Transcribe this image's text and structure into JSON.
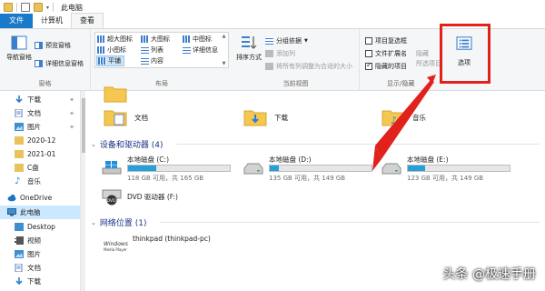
{
  "titlebar": {
    "title": "此电脑"
  },
  "tabs": [
    {
      "label": "文件"
    },
    {
      "label": "计算机"
    },
    {
      "label": "查看"
    }
  ],
  "ribbon": {
    "pane_group": {
      "label": "窗格",
      "nav_pane": "导航窗格",
      "preview_pane": "预览窗格",
      "details_pane": "详细信息窗格"
    },
    "layout_group": {
      "label": "布局",
      "items": [
        "超大图标",
        "大图标",
        "中图标",
        "小图标",
        "列表",
        "详细信息",
        "平铺",
        "内容"
      ],
      "selected": "平铺"
    },
    "current_view_group": {
      "label": "当前视图",
      "sort_by": "排序方式",
      "group_by": "分组依据",
      "add_column": "添加列",
      "fit_columns": "将所有列调整为合适的大小"
    },
    "show_hide_group": {
      "label": "显示/隐藏",
      "item_checkboxes": {
        "label": "项目复选框",
        "checked": false
      },
      "file_extensions": {
        "label": "文件扩展名",
        "checked": false
      },
      "hidden_items": {
        "label": "隐藏的项目",
        "checked": true
      },
      "hide": "隐藏",
      "hide_selected": "所选项目"
    },
    "options": {
      "label": "选项"
    }
  },
  "navpane": {
    "items": [
      {
        "label": "下载",
        "icon": "download-icon",
        "pinned": true
      },
      {
        "label": "文档",
        "icon": "document-icon",
        "pinned": true
      },
      {
        "label": "图片",
        "icon": "picture-icon",
        "pinned": true
      },
      {
        "label": "2020-12",
        "icon": "folder-icon",
        "pinned": false
      },
      {
        "label": "2021-01",
        "icon": "folder-icon",
        "pinned": false
      },
      {
        "label": "C盘",
        "icon": "folder-icon",
        "pinned": false
      },
      {
        "label": "音乐",
        "icon": "music-icon",
        "pinned": false
      },
      {
        "label": "OneDrive",
        "icon": "cloud-icon",
        "pinned": false
      },
      {
        "label": "此电脑",
        "icon": "computer-icon",
        "pinned": false,
        "selected": true
      },
      {
        "label": "Desktop",
        "icon": "desktop-icon",
        "pinned": false
      },
      {
        "label": "视频",
        "icon": "video-icon",
        "pinned": false
      },
      {
        "label": "图片",
        "icon": "picture-icon",
        "pinned": false
      },
      {
        "label": "文档",
        "icon": "document-icon",
        "pinned": false
      },
      {
        "label": "下载",
        "icon": "download-icon",
        "pinned": false
      }
    ]
  },
  "content": {
    "folders": [
      {
        "label": "文档"
      },
      {
        "label": "下载"
      },
      {
        "label": "音乐"
      }
    ],
    "devices_section": "设备和驱动器 (4)",
    "drives": [
      {
        "name": "本地磁盘 (C:)",
        "info": "118 GB 可用，共 165 GB",
        "used_fraction": 0.28
      },
      {
        "name": "本地磁盘 (D:)",
        "info": "135 GB 可用，共 149 GB",
        "used_fraction": 0.09
      },
      {
        "name": "本地磁盘 (E:)",
        "info": "123 GB 可用，共 149 GB",
        "used_fraction": 0.17
      }
    ],
    "dvd": {
      "name": "DVD 驱动器 (F:)",
      "icon_label": "DVD"
    },
    "network_section": "网络位置 (1)",
    "network_item": {
      "name": "thinkpad (thinkpad-pc)",
      "icon_label_1": "Windows",
      "icon_label_2": "Media Player"
    }
  },
  "watermark": "头条 @极速手册",
  "colors": {
    "file_tab": "#1979ca",
    "highlight_box": "#e0211c",
    "drive_bar": "#26a0da",
    "selected_nav": "#cce8ff"
  }
}
